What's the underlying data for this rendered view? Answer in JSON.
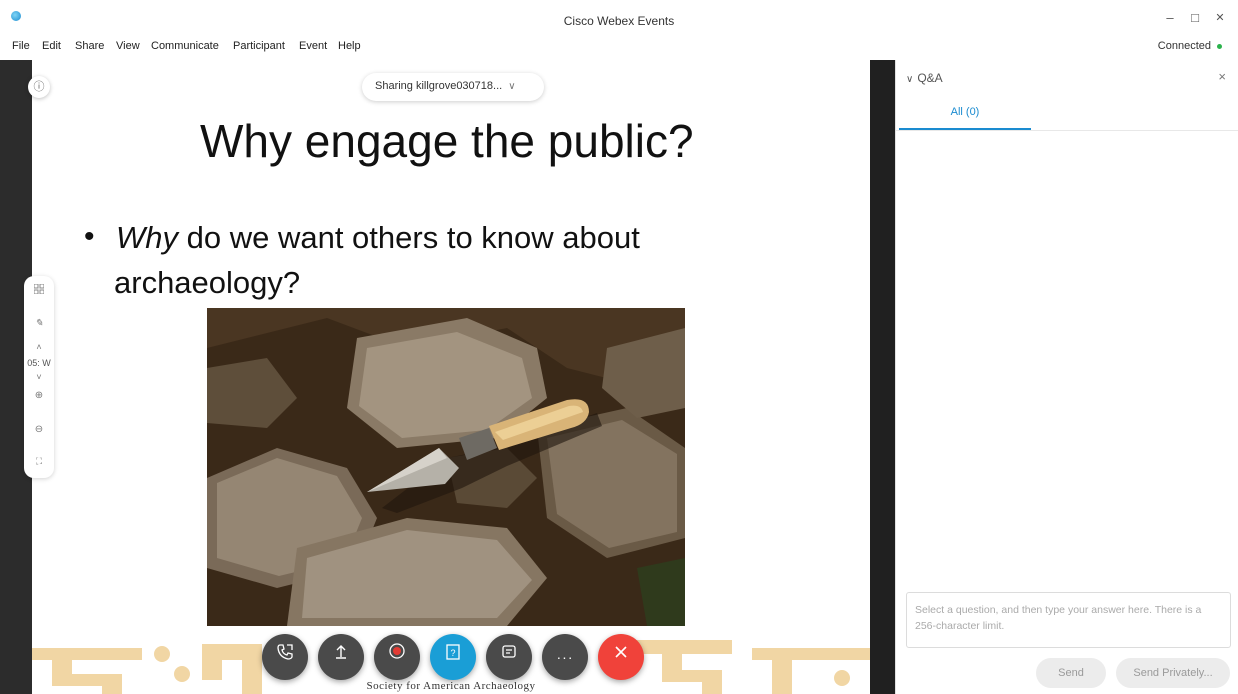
{
  "window": {
    "title": "Cisco Webex Events",
    "minimize": "–",
    "maximize": "□",
    "close": "✕"
  },
  "menu": {
    "items": [
      "File",
      "Edit",
      "Share",
      "View",
      "Communicate",
      "Participant",
      "Event",
      "Help"
    ],
    "status": "Connected"
  },
  "share": {
    "info_icon": "ⓘ",
    "sharing_label": "Sharing killgrove030718...",
    "chevron": "∨"
  },
  "slide": {
    "title": "Why engage the public?",
    "bullet": "•",
    "bullet_italic": "Why",
    "bullet_rest": "do we want others to know about",
    "bullet_line2": "archaeology?",
    "footer_text": "Society for American Archaeology"
  },
  "side_tools": {
    "page_indicator": "05: W"
  },
  "controls": {
    "audio_icon": "audio-icon",
    "share_icon": "share-icon",
    "record_icon": "record-icon",
    "qa_icon": "qa-icon",
    "notes_icon": "notes-icon",
    "more_icon": "more-icon",
    "leave_icon": "leave-icon"
  },
  "qa_panel": {
    "title": "Q&A",
    "tab_all": "All (0)",
    "answer_placeholder": "Select a question, and then type your answer here. There is a 256-character limit.",
    "send_label": "Send",
    "send_private_label": "Send Privately..."
  },
  "colors": {
    "accent": "#1a8bd0",
    "leave": "#f0423a",
    "control": "#4a4a4a",
    "connected": "#2bb24c",
    "footer_gold": "#f1d6a4"
  }
}
